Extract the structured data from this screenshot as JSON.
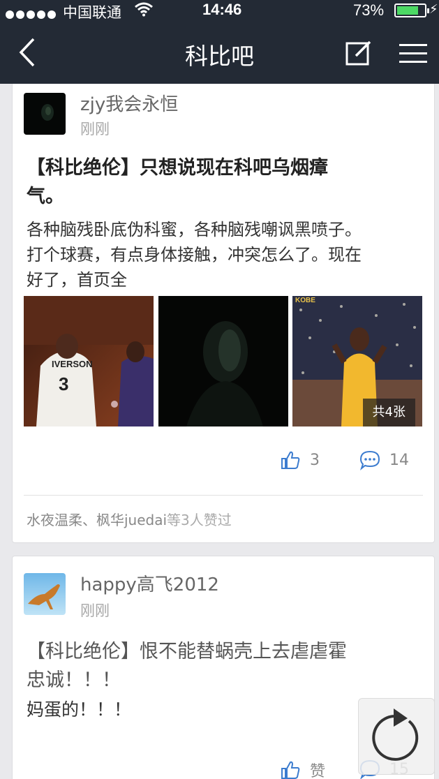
{
  "status_bar": {
    "carrier": "中国联通",
    "time": "14:46",
    "battery": "73%",
    "battery_level": 0.73
  },
  "nav": {
    "title": "科比吧",
    "icons": [
      "chevron-left-icon",
      "compose-icon",
      "menu-icon"
    ]
  },
  "posts": [
    {
      "author": "zjy我会永恒",
      "time": "刚刚",
      "title_line1": "【科比绝伦】只想说现在科吧乌烟瘴",
      "title_line2": "气。",
      "body_line1": "各种脑残卧底伪科蜜，各种脑残嘲讽黑喷子。",
      "body_line2": "打个球赛，有点身体接触，冲突怎么了。现在",
      "body_line3": "好了，首页全",
      "image_count": "共4张",
      "likes": "3",
      "comments": "14",
      "likers_names": "水夜温柔、枫华juedai",
      "likers_suffix": "等3人赞过"
    },
    {
      "author": "happy高飞2012",
      "time": "刚刚",
      "title_line1": "【科比绝伦】恨不能替蜗壳上去虐虐霍",
      "title_line2": "忠诚！！！",
      "body_line1": "妈蛋的！！！",
      "likes": "赞",
      "comments": "15"
    }
  ]
}
